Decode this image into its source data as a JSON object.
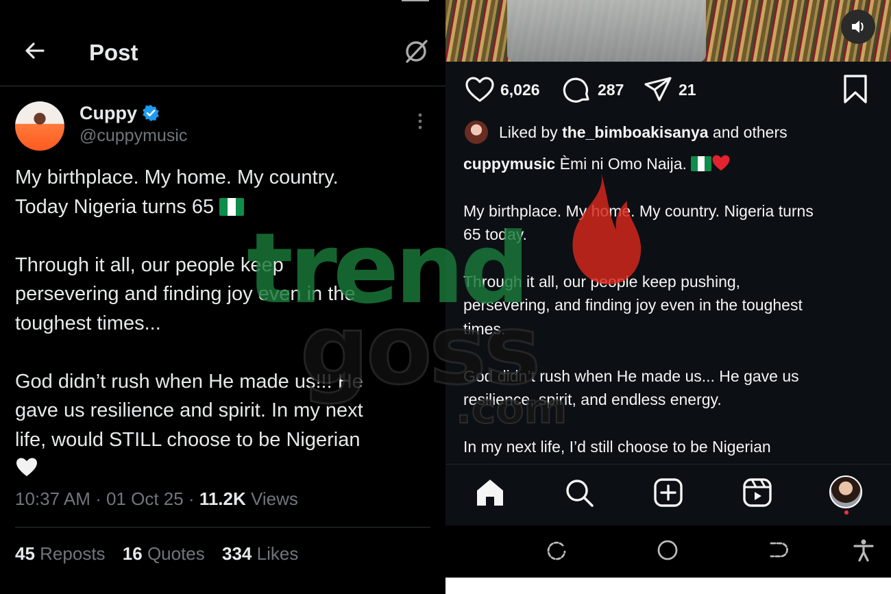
{
  "twitter": {
    "header": {
      "title": "Post"
    },
    "author": {
      "display_name": "Cuppy",
      "handle": "@cuppymusic"
    },
    "tweet": {
      "line1": "My birthplace. My home. My country.",
      "line2": "Today Nigeria turns 65",
      "para2": "Through it all, our people keep\npersevering and finding joy even in the\ntoughest times...",
      "para3": "God didn’t rush when He made us!!! He\ngave us resilience and spirit. In my next\nlife, would STILL choose to be Nigerian"
    },
    "meta": {
      "time": "10:37 AM",
      "date": "01 Oct 25",
      "views_count": "11.2K",
      "views_label": "Views"
    },
    "stats": {
      "reposts_count": "45",
      "reposts_label": "Reposts",
      "quotes_count": "16",
      "quotes_label": "Quotes",
      "likes_count": "334",
      "likes_label": "Likes"
    },
    "icons": {
      "back": "arrow-left-icon",
      "grok": "grok-icon",
      "verified": "verified-badge-icon",
      "more": "more-vertical-icon"
    },
    "colors": {
      "verified": "#1d9bf0",
      "muted": "#71767b"
    }
  },
  "instagram": {
    "actions": {
      "likes": "6,026",
      "comments": "287",
      "shares": "21"
    },
    "liked_by": {
      "prefix": "Liked by",
      "user": "the_bimboakisanya",
      "suffix": "and others"
    },
    "caption": {
      "username": "cuppymusic",
      "headline": "Èmi ni Omo Naija.",
      "p1": "My birthplace. My home. My country. Nigeria turns\n65 today.",
      "p2": "Through it all, our people keep pushing,\npersevering, and finding joy even in the toughest\ntimes.",
      "p3": "God didn’t rush when He made us... He gave us\nresilience, spirit, and endless energy.",
      "p4": "In my next life, I’d still choose to be Nigerian"
    },
    "icons": [
      "home-icon",
      "search-icon",
      "create-icon",
      "reels-icon",
      "profile-avatar"
    ],
    "colors": {
      "notification": "#ff3040"
    }
  },
  "watermark": {
    "line1": "trend",
    "line2": "goss",
    "line3": ".com"
  }
}
